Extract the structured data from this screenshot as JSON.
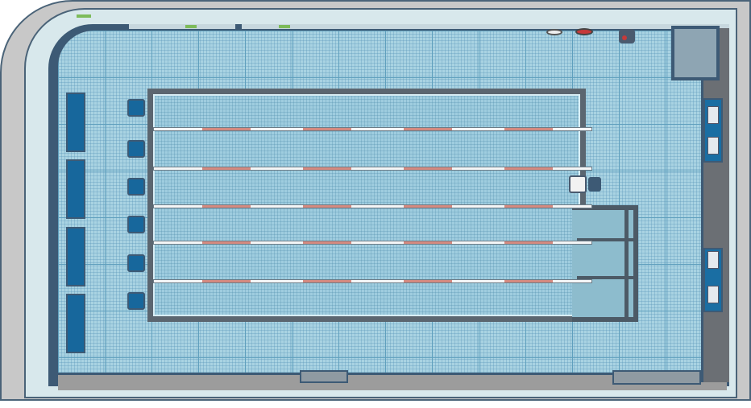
{
  "scene": {
    "type": "top-down swimming pool floor plan",
    "lanes": 6,
    "lane_ropes": 5,
    "colors": {
      "floor": "#a9d3e2",
      "pool_edge": "#5b6670",
      "lane_rope_marker": "#d48a80",
      "bench": "#17679c",
      "wall": "#c8c8c8"
    }
  }
}
